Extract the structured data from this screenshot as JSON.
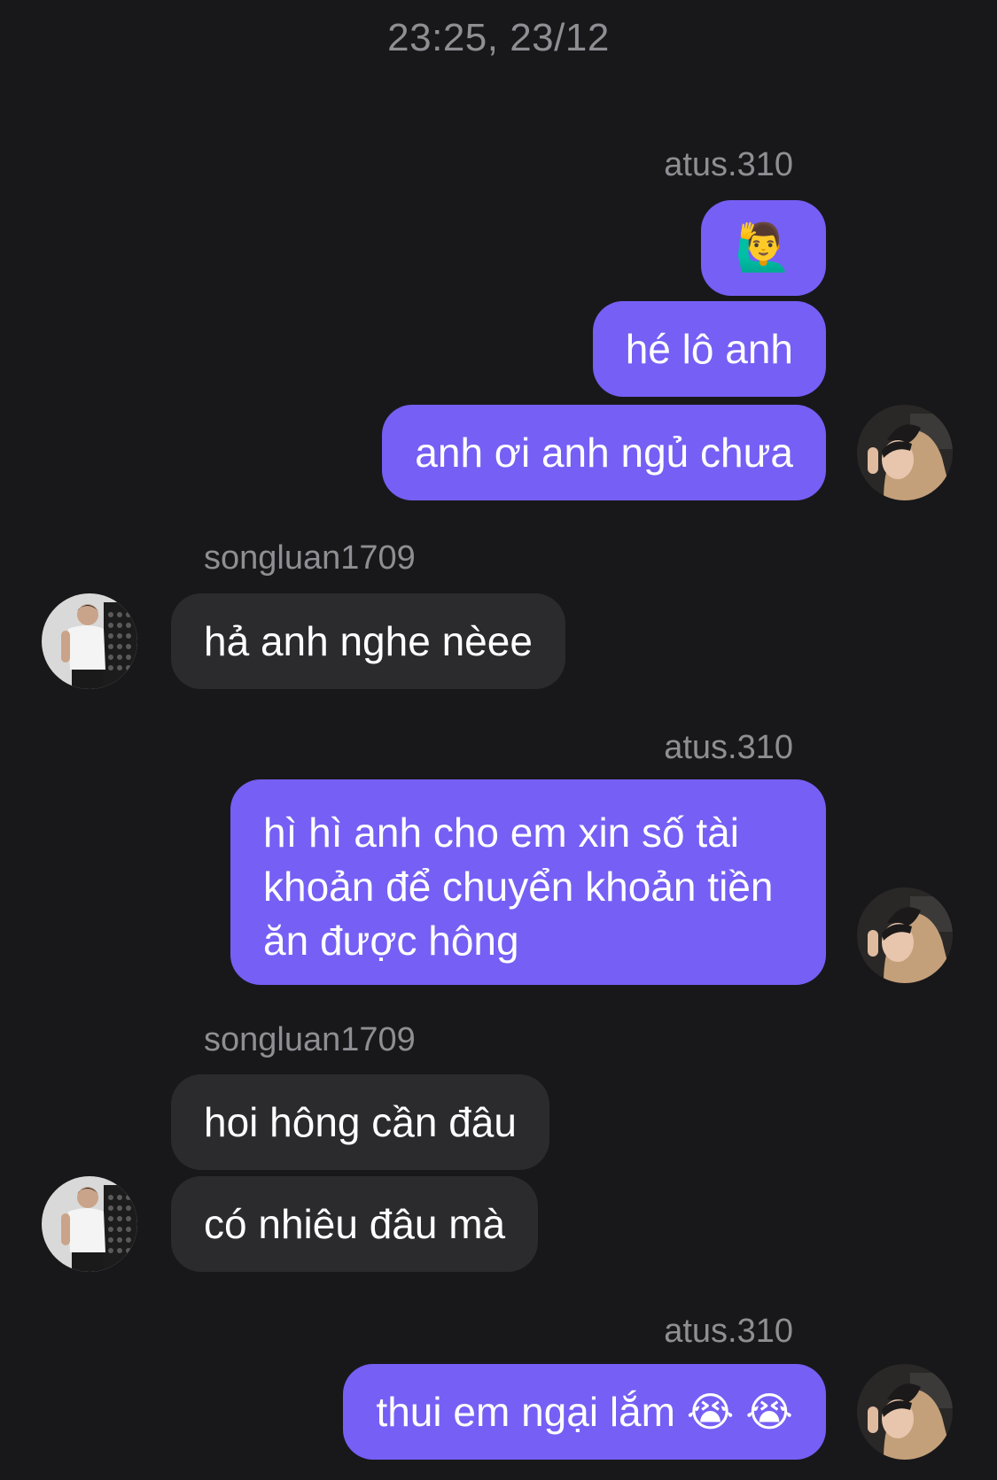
{
  "chat": {
    "timestamp": "23:25, 23/12",
    "sender_me": "atus.310",
    "sender_them": "songluan1709",
    "messages": [
      {
        "from": "me",
        "text": "🙋‍♂️"
      },
      {
        "from": "me",
        "text": "hé lô anh"
      },
      {
        "from": "me",
        "text": "anh ơi anh ngủ chưa"
      },
      {
        "from": "them",
        "text": "hả anh nghe nèee"
      },
      {
        "from": "me",
        "text": "hì hì anh cho em xin số tài khoản để chuyển khoản tiền ăn được hông"
      },
      {
        "from": "them",
        "text": "hoi hông cần đâu"
      },
      {
        "from": "them",
        "text": "có nhiêu đâu mà"
      },
      {
        "from": "me",
        "text": "thui em ngại lắm 😭 😭"
      }
    ]
  },
  "colors": {
    "background": "#18181b",
    "bubble_me": "#765ff5",
    "bubble_them": "#2b2b2e",
    "meta_text": "#8e8e93"
  },
  "icons": {
    "avatar_me": "avatar-photo-hoodie",
    "avatar_them": "avatar-photo-white-shirt"
  }
}
